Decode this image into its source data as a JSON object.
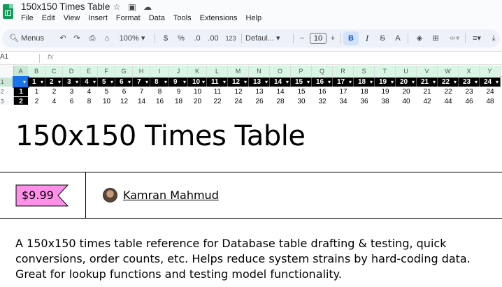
{
  "sheet": {
    "doc_title": "150x150 Times Table",
    "menu": [
      "File",
      "Edit",
      "View",
      "Insert",
      "Format",
      "Data",
      "Tools",
      "Extensions",
      "Help"
    ],
    "toolbar": {
      "search_label": "Menus",
      "zoom": "100%",
      "currency": "$",
      "percent": "%",
      "dec_decrease": ".0",
      "dec_increase": ".00",
      "number_format": "123",
      "font": "Defaul...",
      "font_size": "10",
      "bold": "B",
      "italic": "I",
      "strike": "S",
      "text_color": "A"
    },
    "name_box": "A1",
    "fx": "fx",
    "columns": [
      "A",
      "B",
      "C",
      "D",
      "E",
      "F",
      "G",
      "H",
      "I",
      "J",
      "K",
      "L",
      "M",
      "N",
      "O",
      "P",
      "Q",
      "R",
      "S",
      "T",
      "U",
      "V",
      "W",
      "X",
      "Y"
    ],
    "row_numbers": [
      "1",
      "2",
      "3"
    ],
    "header_values": [
      "1",
      "2",
      "3",
      "4",
      "5",
      "6",
      "7",
      "8",
      "9",
      "10",
      "11",
      "12",
      "13",
      "14",
      "15",
      "16",
      "17",
      "18",
      "19",
      "20",
      "21",
      "22",
      "23",
      "24"
    ],
    "row2": [
      "1",
      "1",
      "2",
      "3",
      "4",
      "5",
      "6",
      "7",
      "8",
      "9",
      "10",
      "11",
      "12",
      "13",
      "14",
      "15",
      "16",
      "17",
      "18",
      "19",
      "20",
      "21",
      "22",
      "23",
      "24"
    ],
    "row3": [
      "2",
      "2",
      "4",
      "6",
      "8",
      "10",
      "12",
      "14",
      "16",
      "18",
      "20",
      "22",
      "24",
      "26",
      "28",
      "30",
      "32",
      "34",
      "36",
      "38",
      "40",
      "42",
      "44",
      "46",
      "48"
    ]
  },
  "product": {
    "title": "150x150 Times Table",
    "price": "$9.99",
    "author": "Kamran Mahmud",
    "description": "A 150x150 times table reference for Database table drafting & testing, quick conversions, order counts, etc. Helps reduce system strains by hard-coding data. Great for lookup functions and testing model functionality."
  },
  "colors": {
    "price_tag_fill": "#ff90e8",
    "sheets_green": "#0f9d58",
    "header_fill": "#000000",
    "selection_blue": "#1a73e8"
  }
}
